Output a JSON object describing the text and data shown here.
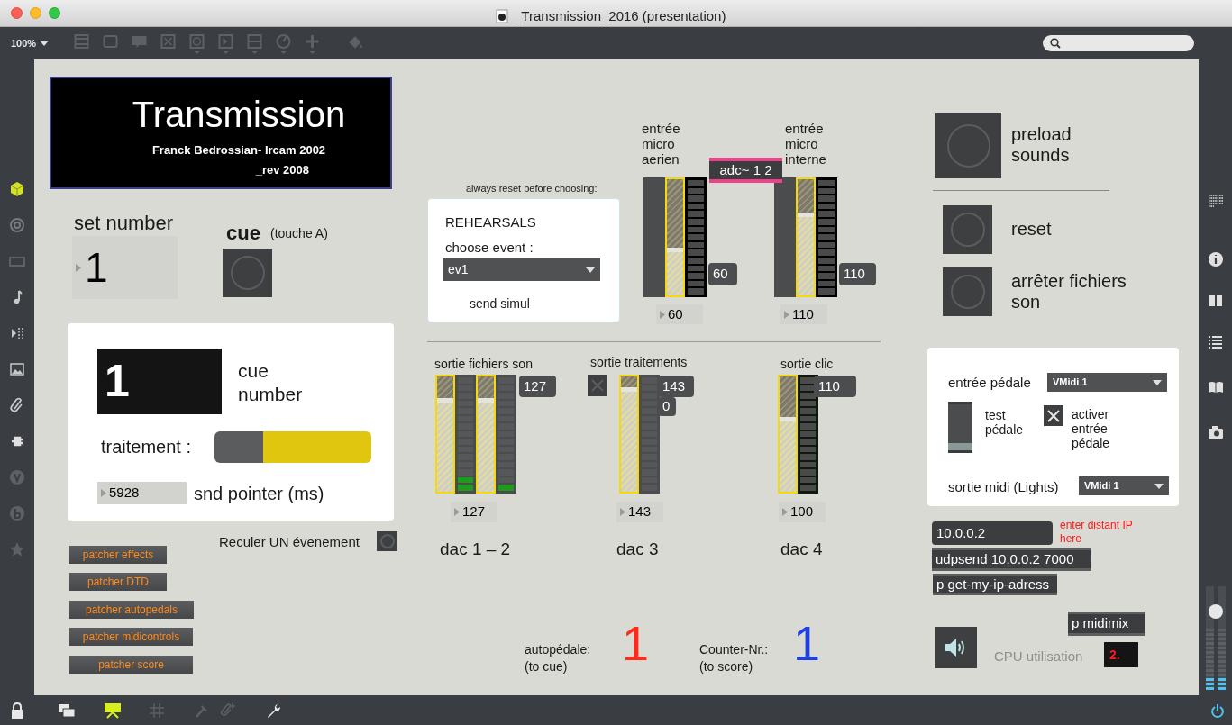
{
  "window": {
    "title": "_Transmission_2016 (presentation)"
  },
  "toolbar": {
    "zoom": "100%"
  },
  "title_box": {
    "title": "Transmission",
    "credit": "Franck Bedrossian- Ircam 2002",
    "revision": "_rev 2008"
  },
  "set_number": {
    "label": "set number",
    "value": "1"
  },
  "cue": {
    "label": "cue",
    "hint": "(touche A)"
  },
  "cue_panel": {
    "value": "1",
    "label": "cue number",
    "traitement_label": "traitement :",
    "traitement_on": true,
    "pointer_value": "5928",
    "pointer_label": "snd pointer (ms)"
  },
  "reculer": {
    "label": "Reculer UN évenement"
  },
  "patchers": [
    "patcher effects",
    "patcher DTD",
    "patcher autopedals",
    "patcher midicontrols",
    "patcher score"
  ],
  "rehearsals": {
    "note": "always reset before choosing:",
    "title": "REHEARSALS",
    "label": "choose event :",
    "event": "ev1",
    "send": "send simul"
  },
  "inputs": {
    "adc": "adc~ 1 2",
    "channels": [
      {
        "label": "entrée micro aerien",
        "level": 0.41,
        "meter": {
          "level": 0
        },
        "badge": "60",
        "number": "60"
      },
      {
        "label": "entrée micro interne",
        "level": 0.71,
        "meter": {
          "level": 0
        },
        "badge": "110",
        "number": "110"
      }
    ]
  },
  "outputs": [
    {
      "label": "sortie fichiers son",
      "strips": [
        {
          "level": 0.81,
          "meter": {
            "level": 0.12
          }
        },
        {
          "level": 0.81,
          "meter": {
            "level": 0.06
          }
        }
      ],
      "badges": [
        "127"
      ],
      "number": "127",
      "dac": "dac 1 – 2"
    },
    {
      "label": "sortie traitements",
      "toggle_checked": false,
      "strips": [
        {
          "level": 0.91,
          "meter": {
            "level": 0
          }
        }
      ],
      "badges": [
        "143",
        "0"
      ],
      "number": "143",
      "dac": "dac 3"
    },
    {
      "label": "sortie clic",
      "strips": [
        {
          "level": 0.65,
          "meter": {
            "level": 0
          }
        }
      ],
      "badges": [
        "110"
      ],
      "number": "100",
      "dac": "dac 4"
    }
  ],
  "counters": [
    {
      "label": "autopédale:",
      "sub": "(to cue)",
      "value": "1",
      "color": "#ff2a1a"
    },
    {
      "label": "Counter-Nr.:",
      "sub": "(to score)",
      "value": "1",
      "color": "#1f3fe6"
    }
  ],
  "buttons": [
    {
      "label": "preload sounds"
    },
    {
      "label": "reset"
    },
    {
      "label": "arrêter fichiers son"
    }
  ],
  "pedal": {
    "input_label": "entrée pédale",
    "input_device": "VMidi 1",
    "test_label": "test pédale",
    "test_slider": {
      "level": 0.15
    },
    "activate_label": "activer entrée pédale",
    "activate_checked": true,
    "output_label": "sortie midi (Lights)",
    "output_device": "VMidi 1"
  },
  "network": {
    "ip": "10.0.0.2",
    "ip_hint": "enter distant IP here",
    "udpsend": "udpsend 10.0.0.2 7000",
    "get_ip": "p get-my-ip-adress",
    "midimix": "p midimix"
  },
  "cpu": {
    "label": "CPU utilisation",
    "value": "2."
  },
  "volume": {
    "level": 0.76
  }
}
